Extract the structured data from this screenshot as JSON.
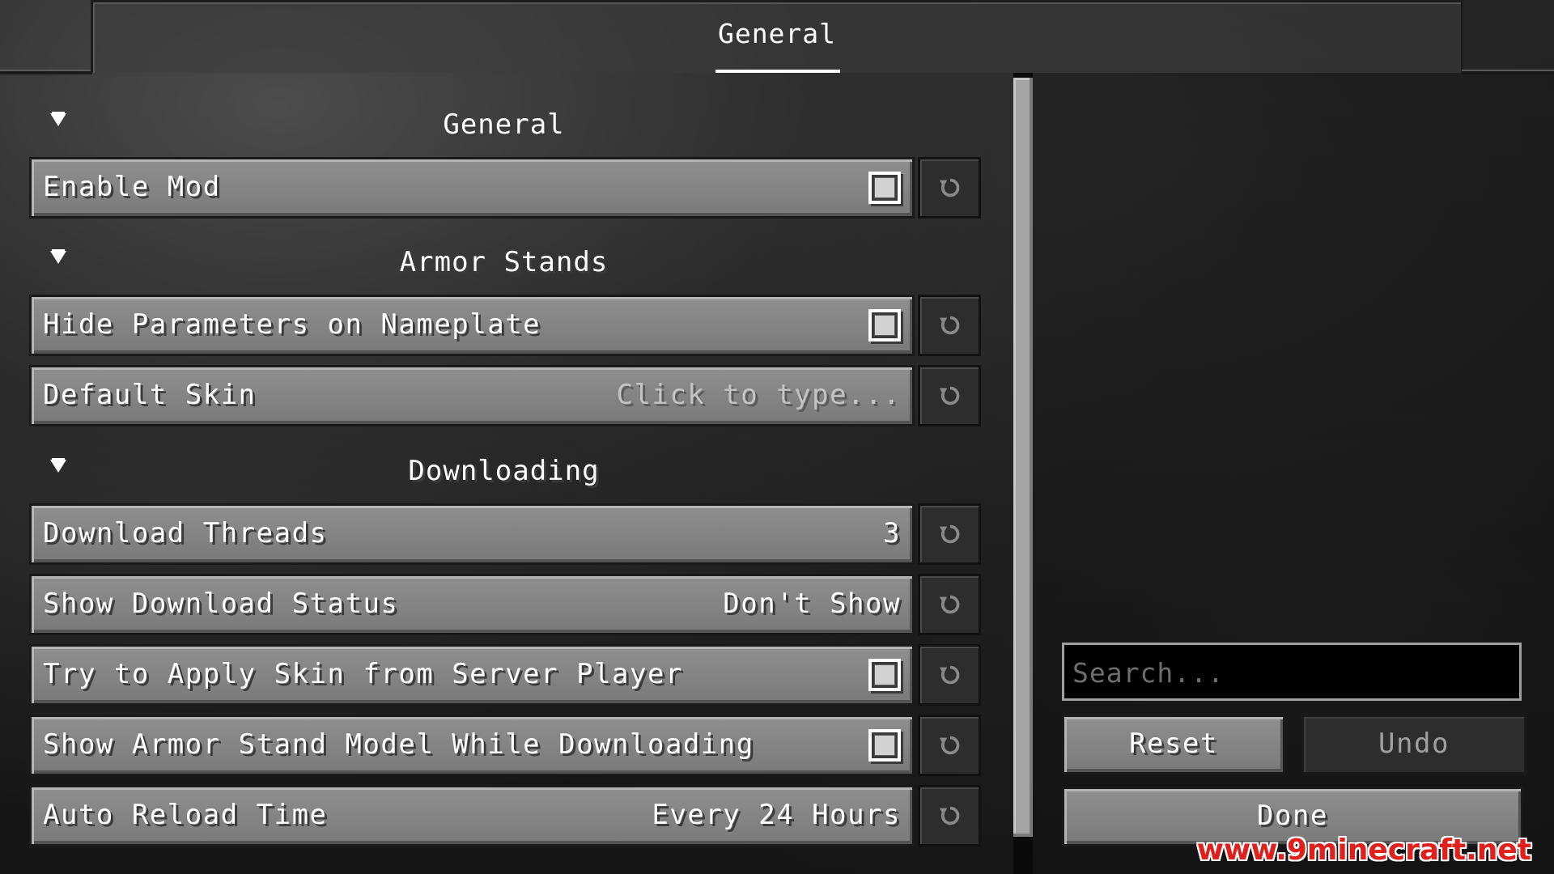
{
  "tabs": [
    {
      "label": "General",
      "active": true
    }
  ],
  "sections": [
    {
      "title": "General"
    },
    {
      "title": "Armor Stands"
    },
    {
      "title": "Downloading"
    }
  ],
  "entries": [
    {
      "label": "Enable Mod",
      "type": "checkbox",
      "checked": true
    },
    {
      "label": "Hide Parameters on Nameplate",
      "type": "checkbox",
      "checked": true
    },
    {
      "label": "Default Skin",
      "type": "text",
      "placeholder": "Click to type..."
    },
    {
      "label": "Download Threads",
      "type": "number",
      "value": "3"
    },
    {
      "label": "Show Download Status",
      "type": "enum",
      "value": "Don't Show"
    },
    {
      "label": "Try to Apply Skin from Server Player",
      "type": "checkbox",
      "checked": true
    },
    {
      "label": "Show Armor Stand Model While Downloading",
      "type": "checkbox",
      "checked": true
    },
    {
      "label": "Auto Reload Time",
      "type": "enum",
      "value": "Every 24 Hours"
    }
  ],
  "search": {
    "placeholder": "Search...",
    "value": ""
  },
  "buttons": {
    "reset": "Reset",
    "undo": "Undo",
    "done": "Done"
  },
  "watermark": "www.9minecraft.net",
  "icons": {
    "section_toggle": "triangle-down-icon",
    "entry_reset": "reset-arrow-icon"
  },
  "colors": {
    "entry_bg": "#848484",
    "disabled_bg": "#2d2d2d",
    "tab_underline": "#ffffff",
    "watermark": "#e0201c"
  }
}
